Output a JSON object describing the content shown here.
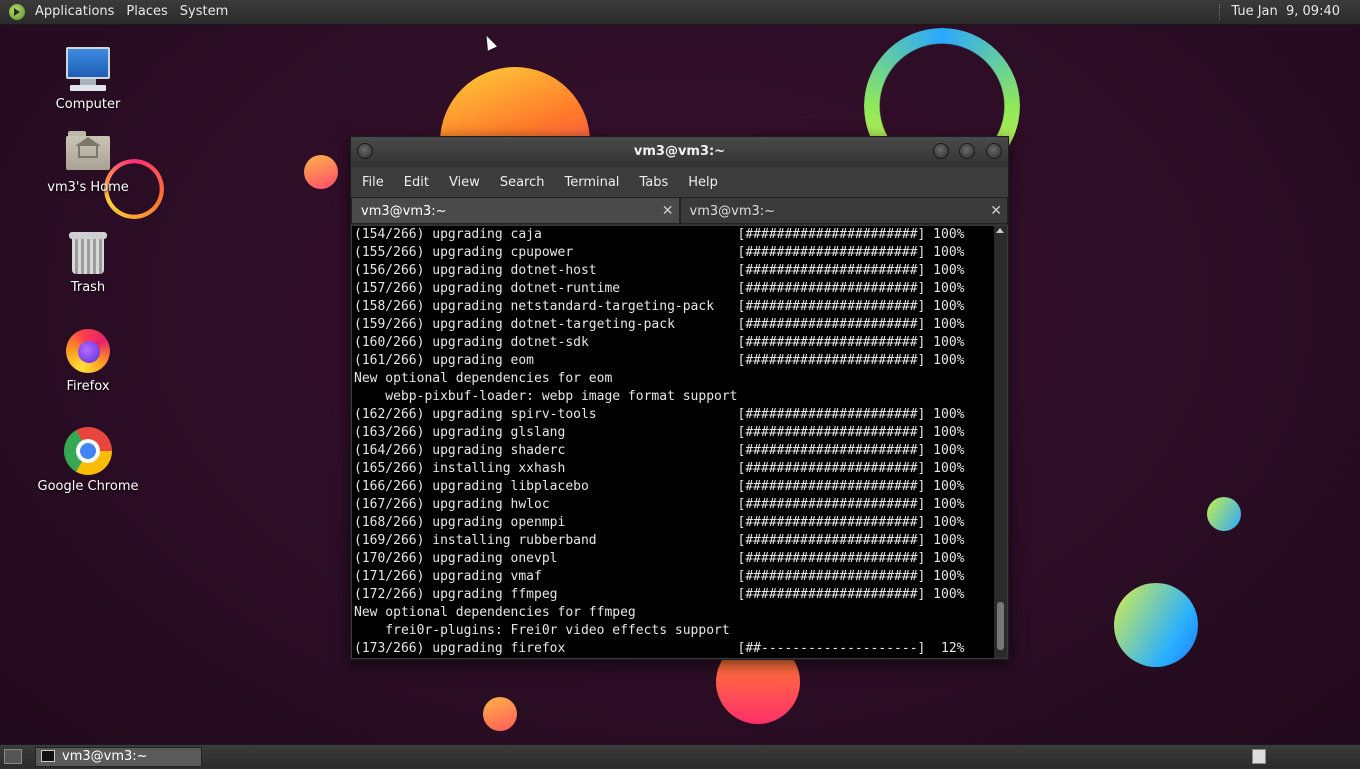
{
  "top_panel": {
    "menus": [
      "Applications",
      "Places",
      "System"
    ],
    "clock": "Tue Jan  9, 09:40"
  },
  "desktop_icons": [
    {
      "label": "Computer",
      "icon": "computer-icon"
    },
    {
      "label": "vm3's Home",
      "icon": "home-folder-icon"
    },
    {
      "label": "Trash",
      "icon": "trash-icon"
    },
    {
      "label": "Firefox",
      "icon": "firefox-icon"
    },
    {
      "label": "Google Chrome",
      "icon": "chrome-icon"
    }
  ],
  "terminal": {
    "title": "vm3@vm3:~",
    "menu": [
      "File",
      "Edit",
      "View",
      "Search",
      "Terminal",
      "Tabs",
      "Help"
    ],
    "tabs": [
      {
        "label": "vm3@vm3:~",
        "active": true
      },
      {
        "label": "vm3@vm3:~",
        "active": false
      }
    ],
    "lines": [
      "(154/266) upgrading caja                         [######################] 100%",
      "(155/266) upgrading cpupower                     [######################] 100%",
      "(156/266) upgrading dotnet-host                  [######################] 100%",
      "(157/266) upgrading dotnet-runtime               [######################] 100%",
      "(158/266) upgrading netstandard-targeting-pack   [######################] 100%",
      "(159/266) upgrading dotnet-targeting-pack        [######################] 100%",
      "(160/266) upgrading dotnet-sdk                   [######################] 100%",
      "(161/266) upgrading eom                          [######################] 100%",
      "New optional dependencies for eom",
      "    webp-pixbuf-loader: webp image format support",
      "(162/266) upgrading spirv-tools                  [######################] 100%",
      "(163/266) upgrading glslang                      [######################] 100%",
      "(164/266) upgrading shaderc                      [######################] 100%",
      "(165/266) installing xxhash                      [######################] 100%",
      "(166/266) upgrading libplacebo                   [######################] 100%",
      "(167/266) upgrading hwloc                        [######################] 100%",
      "(168/266) upgrading openmpi                      [######################] 100%",
      "(169/266) installing rubberband                  [######################] 100%",
      "(170/266) upgrading onevpl                       [######################] 100%",
      "(171/266) upgrading vmaf                         [######################] 100%",
      "(172/266) upgrading ffmpeg                       [######################] 100%",
      "New optional dependencies for ffmpeg",
      "    frei0r-plugins: Frei0r video effects support",
      "(173/266) upgrading firefox                      [##--------------------]  12%"
    ]
  },
  "taskbar": {
    "items": [
      {
        "label": "vm3@vm3:~"
      }
    ]
  }
}
